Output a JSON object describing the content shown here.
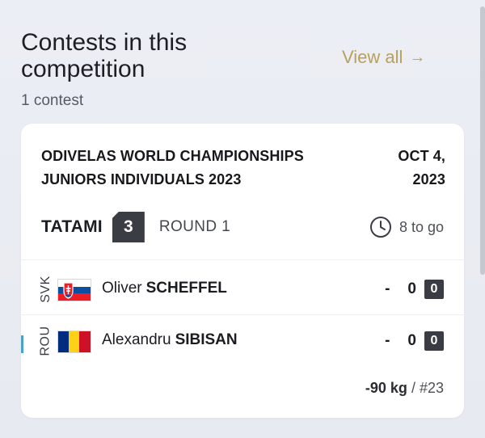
{
  "header": {
    "title": "Contests in this competition",
    "count": "1 contest",
    "view_all": "View all",
    "view_all_arrow": "→"
  },
  "contest": {
    "event_line1": "ODIVELAS WORLD CHAMPIONSHIPS",
    "event_line2": "JUNIORS INDIVIDUALS 2023",
    "date_line1": "OCT 4,",
    "date_line2": "2023",
    "tatami_label": "TATAMI",
    "tatami_number": "3",
    "round": "ROUND 1",
    "to_go": "8 to go",
    "competitors": [
      {
        "country": "SVK",
        "first_name": "Oliver",
        "last_name": "SCHEFFEL",
        "dash": "-",
        "score": "0",
        "penalty": "0"
      },
      {
        "country": "ROU",
        "first_name": "Alexandru",
        "last_name": "SIBISAN",
        "dash": "-",
        "score": "0",
        "penalty": "0"
      }
    ],
    "weight": "-90 kg",
    "contest_number": "/ #23"
  },
  "colors": {
    "accent": "#b9a15a",
    "active_indicator": "#4aa3c7",
    "badge": "#3b3d44"
  },
  "icons": {
    "clock": "clock-icon",
    "arrow": "arrow-right-icon"
  }
}
